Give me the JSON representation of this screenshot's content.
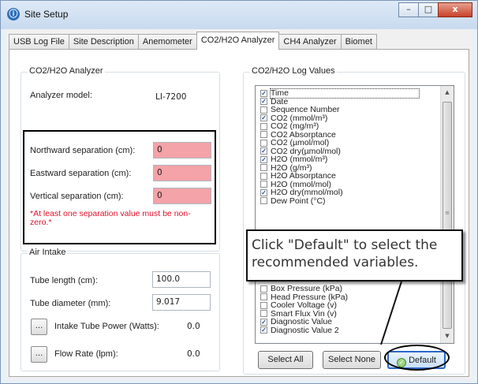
{
  "window": {
    "title": "Site Setup",
    "controls": {
      "minimize": "–",
      "maximize": "□",
      "close": "x"
    }
  },
  "tabs": [
    {
      "label": "USB Log File",
      "active": false
    },
    {
      "label": "Site Description",
      "active": false
    },
    {
      "label": "Anemometer",
      "active": false
    },
    {
      "label": "CO2/H2O Analyzer",
      "active": true
    },
    {
      "label": "CH4 Analyzer",
      "active": false
    },
    {
      "label": "Biomet",
      "active": false
    }
  ],
  "analyzer_group": {
    "title": "CO2/H2O Analyzer",
    "model_label": "Analyzer model:",
    "model_value": "LI-7200",
    "northward_label": "Northward separation (cm):",
    "northward_value": "0",
    "eastward_label": "Eastward separation (cm):",
    "eastward_value": "0",
    "vertical_label": "Vertical separation (cm):",
    "vertical_value": "0",
    "error_text": "*At least one separation value must be non-zero.*"
  },
  "air_intake": {
    "title": "Air Intake",
    "tube_length_label": "Tube length (cm):",
    "tube_length_value": "100.0",
    "tube_diameter_label": "Tube diameter (mm):",
    "tube_diameter_value": "9.017",
    "power_button": "...",
    "power_label": "Intake Tube Power (Watts):",
    "power_value": "0.0",
    "flow_button": "...",
    "flow_label": "Flow Rate (lpm):",
    "flow_value": "0.0"
  },
  "log_values": {
    "title": "CO2/H2O Log Values",
    "items": [
      {
        "label": "Time",
        "checked": true
      },
      {
        "label": "Date",
        "checked": true
      },
      {
        "label": "Sequence Number",
        "checked": false
      },
      {
        "label": "CO2 (mmol/m³)",
        "checked": true
      },
      {
        "label": "CO2 (mg/m³)",
        "checked": false
      },
      {
        "label": "CO2 Absorptance",
        "checked": false
      },
      {
        "label": "CO2 (µmol/mol)",
        "checked": false
      },
      {
        "label": "CO2 dry(µmol/mol)",
        "checked": true
      },
      {
        "label": "H2O (mmol/m³)",
        "checked": true
      },
      {
        "label": "H2O (g/m³)",
        "checked": false
      },
      {
        "label": "H2O Absorptance",
        "checked": false
      },
      {
        "label": "H2O (mmol/mol)",
        "checked": false
      },
      {
        "label": "H2O dry(mmol/mol)",
        "checked": true
      },
      {
        "label": "Dew Point (°C)",
        "checked": false
      },
      {
        "label": "Box Pressure (kPa)",
        "checked": false
      },
      {
        "label": "Head Pressure (kPa)",
        "checked": false
      },
      {
        "label": "Cooler Voltage (v)",
        "checked": false
      },
      {
        "label": "Smart Flux Vin (v)",
        "checked": false
      },
      {
        "label": "Diagnostic Value",
        "checked": true
      },
      {
        "label": "Diagnostic Value 2",
        "checked": true
      }
    ],
    "select_all": "Select All",
    "select_none": "Select None",
    "default": "Default"
  },
  "callout": {
    "text": "Click \"Default\" to select the recommended variables."
  },
  "colors": {
    "error_field": "#f4a3a8",
    "error_text": "#e0102a",
    "default_border": "#2b66c7"
  }
}
